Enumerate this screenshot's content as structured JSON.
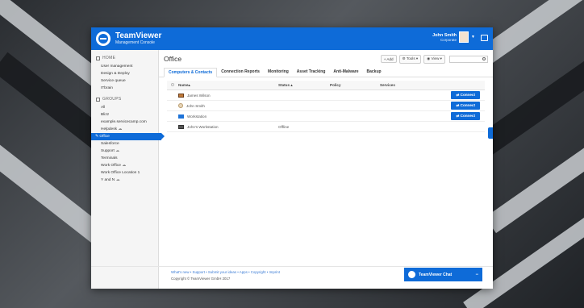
{
  "app": {
    "brand": "TeamViewer",
    "brand_sub": "Management Console",
    "user_name": "John Smith",
    "user_role": "Corporate"
  },
  "sidebar": {
    "home_label": "HOME",
    "home_items": [
      "User management",
      "Design & Deploy",
      "Service queue",
      "ITbrain"
    ],
    "groups_label": "GROUPS",
    "groups": [
      {
        "label": "All",
        "cloud": false
      },
      {
        "label": "Blizz",
        "cloud": false
      },
      {
        "label": "example.servicecamp.com",
        "cloud": false
      },
      {
        "label": "Helpdesk",
        "cloud": true
      },
      {
        "label": "Office",
        "cloud": false,
        "active": true
      },
      {
        "label": "Salesforce",
        "cloud": false,
        "sub": true
      },
      {
        "label": "Support",
        "cloud": true,
        "sub": true
      },
      {
        "label": "Terminals",
        "cloud": false,
        "sub": true
      },
      {
        "label": "Work Office",
        "cloud": true,
        "sub": true
      },
      {
        "label": "Work Office Location 1",
        "cloud": false,
        "sub": true
      },
      {
        "label": "Y and N",
        "cloud": true,
        "sub": true
      }
    ]
  },
  "main": {
    "title": "Office",
    "toolbar": {
      "add": "+ Add",
      "tools": "Tools",
      "view": "View"
    },
    "tabs": [
      "Computers & Contacts",
      "Connection Reports",
      "Monitoring",
      "Asset Tracking",
      "Anti-Malware",
      "Backup"
    ],
    "active_tab": 0,
    "columns": [
      "Name",
      "Status",
      "Policy",
      "Services"
    ],
    "rows": [
      {
        "name": "James Wilson",
        "status": "",
        "icon": "photo",
        "connect": "Connect"
      },
      {
        "name": "John Smith",
        "status": "",
        "icon": "person",
        "connect": "Connect"
      },
      {
        "name": "Workstation",
        "status": "",
        "icon": "win",
        "connect": "Connect"
      },
      {
        "name": "John's Workstation",
        "status": "Offline",
        "icon": "off",
        "connect": ""
      }
    ]
  },
  "footer": {
    "links": "What's new • Support • Submit your ideas • Apps • Copyright • Imprint",
    "copyright": "Copyright © TeamViewer GmbH 2017"
  },
  "chat": {
    "label": "TeamViewer Chat"
  },
  "colors": {
    "accent": "#0e6bd8"
  }
}
